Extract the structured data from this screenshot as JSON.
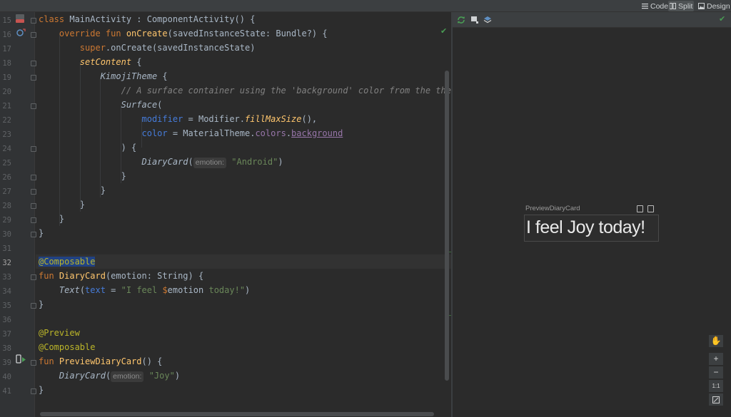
{
  "modes": [
    {
      "label": "Code",
      "icon": "lines-icon",
      "active": false
    },
    {
      "label": "Split",
      "icon": "split-icon",
      "active": true
    },
    {
      "label": "Design",
      "icon": "image-icon",
      "active": false
    }
  ],
  "editor": {
    "line_numbers": [
      "15",
      "16",
      "17",
      "18",
      "19",
      "20",
      "21",
      "22",
      "23",
      "24",
      "25",
      "26",
      "27",
      "28",
      "29",
      "30",
      "31",
      "32",
      "33",
      "34",
      "35",
      "36",
      "37",
      "38",
      "39",
      "40",
      "41"
    ],
    "current_line": "32",
    "code": {
      "l15": {
        "kw": "class ",
        "name": "MainActivity : ComponentActivity() {"
      },
      "l16": {
        "kw": "override fun ",
        "fn": "onCreate",
        "rest": "(savedInstanceState: Bundle?) {"
      },
      "l17": {
        "kw": "super",
        "rest": ".onCreate(savedInstanceState)"
      },
      "l18": {
        "fn": "setContent",
        "rest": " {"
      },
      "l19": {
        "it": "KimojiTheme",
        "rest": " {"
      },
      "l20": {
        "comment": "// A surface container using the 'background' color from the theme"
      },
      "l21": {
        "it": "Surface",
        "rest": "("
      },
      "l22": {
        "named": "modifier",
        "eq": " = Modifier.",
        "fn": "fillMaxSize",
        "rest": "(),"
      },
      "l23": {
        "named": "color",
        "eq": " = MaterialTheme.",
        "prop": "colors",
        "dot": ".",
        "prop2": "background"
      },
      "l24": {
        "rest": ") {"
      },
      "l25": {
        "it": "DiaryCard",
        "open": "(",
        "hint": "emotion:",
        "str": "\"Android\"",
        "close": ")"
      },
      "l26": {
        "rest": "}"
      },
      "l27": {
        "rest": "}"
      },
      "l28": {
        "rest": "}"
      },
      "l29": {
        "rest": "}"
      },
      "l30": {
        "rest": "}"
      },
      "l32": {
        "ann": "@Composable"
      },
      "l33": {
        "kw": "fun ",
        "fn": "DiaryCard",
        "rest": "(emotion: String) {"
      },
      "l34": {
        "it": "Text",
        "open": "(",
        "named": "text",
        "eq": " = ",
        "str1": "\"I feel ",
        "var": "$",
        "plain": "emotion",
        "str2": " today!\"",
        "close": ")"
      },
      "l35": {
        "rest": "}"
      },
      "l37": {
        "ann": "@Preview"
      },
      "l38": {
        "ann": "@Composable"
      },
      "l39": {
        "kw": "fun ",
        "fn": "PreviewDiaryCard",
        "rest": "() {"
      },
      "l40": {
        "it": "DiaryCard",
        "open": "(",
        "hint": "emotion:",
        "str": "\"Joy\"",
        "close": ")"
      },
      "l41": {
        "rest": "}"
      }
    }
  },
  "preview": {
    "label": "PreviewDiaryCard",
    "rendered_text": "I feel Joy today!",
    "zoom_controls": [
      "+",
      "−",
      "1:1"
    ]
  },
  "colors": {
    "keyword": "#cc7832",
    "function": "#ffc66d",
    "string": "#6a8759",
    "annotation": "#bbb529",
    "comment": "#808080",
    "check": "#499c54"
  }
}
